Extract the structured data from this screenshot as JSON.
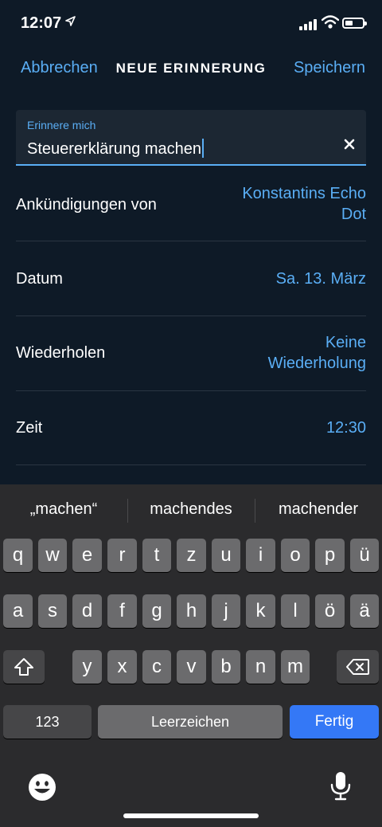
{
  "status_bar": {
    "time": "12:07"
  },
  "nav": {
    "cancel": "Abbrechen",
    "title": "NEUE ERINNERUNG",
    "save": "Speichern"
  },
  "reminder_input": {
    "label": "Erinnere mich",
    "value": "Steuererklärung machen"
  },
  "rows": [
    {
      "label": "Ankündigungen von",
      "value_line1": "Konstantins Echo",
      "value_line2": "Dot"
    },
    {
      "label": "Datum",
      "value": "Sa. 13. März"
    },
    {
      "label": "Wiederholen",
      "value_line1": "Keine",
      "value_line2": "Wiederholung"
    },
    {
      "label": "Zeit",
      "value": "12:30"
    }
  ],
  "keyboard": {
    "suggestions": [
      "„machen“",
      "machendes",
      "machender"
    ],
    "row1": [
      "q",
      "w",
      "e",
      "r",
      "t",
      "z",
      "u",
      "i",
      "o",
      "p",
      "ü"
    ],
    "row2": [
      "a",
      "s",
      "d",
      "f",
      "g",
      "h",
      "j",
      "k",
      "l",
      "ö",
      "ä"
    ],
    "row3": [
      "y",
      "x",
      "c",
      "v",
      "b",
      "n",
      "m"
    ],
    "numbers_key": "123",
    "space_key": "Leerzeichen",
    "return_key": "Fertig"
  },
  "colors": {
    "accent": "#5aaef5",
    "background": "#0e1a27",
    "return_key": "#3478f6"
  }
}
